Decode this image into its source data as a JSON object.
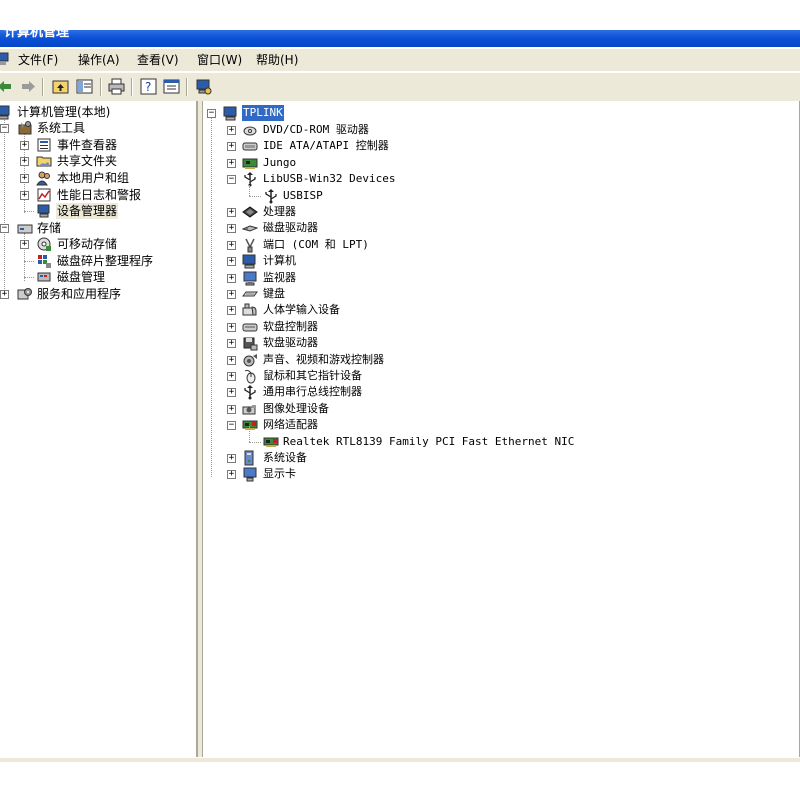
{
  "window": {
    "title": "计算机管理"
  },
  "menu": {
    "file": "文件(F)",
    "action": "操作(A)",
    "view": "查看(V)",
    "window": "窗口(W)",
    "help": "帮助(H)"
  },
  "toolbar": {
    "icons": [
      "back-arrow-icon",
      "forward-arrow-icon",
      "up-folder-icon",
      "show-tree-icon",
      "print-icon",
      "help-icon",
      "properties-icon",
      "scan-hardware-icon"
    ]
  },
  "left_tree": {
    "root": "计算机管理(本地)",
    "system_tools": "系统工具",
    "event_viewer": "事件查看器",
    "shared_folders": "共享文件夹",
    "local_users": "本地用户和组",
    "perf_logs": "性能日志和警报",
    "device_manager": "设备管理器",
    "storage": "存储",
    "removable_storage": "可移动存储",
    "defrag": "磁盘碎片整理程序",
    "disk_management": "磁盘管理",
    "services_apps": "服务和应用程序"
  },
  "device_tree": {
    "root": "TPLINK",
    "items": [
      {
        "label": "DVD/CD-ROM 驱动器",
        "icon": "cdrom-icon",
        "expanded": false
      },
      {
        "label": "IDE ATA/ATAPI 控制器",
        "icon": "ide-controller-icon",
        "expanded": false
      },
      {
        "label": "Jungo",
        "icon": "jungo-card-icon",
        "expanded": false
      },
      {
        "label": "LibUSB-Win32 Devices",
        "icon": "usb-icon",
        "expanded": true
      },
      {
        "label": "USBISP",
        "icon": "usb-icon",
        "child": true
      },
      {
        "label": "处理器",
        "icon": "processor-icon",
        "expanded": false
      },
      {
        "label": "磁盘驱动器",
        "icon": "disk-drive-icon",
        "expanded": false
      },
      {
        "label": "端口 (COM 和 LPT)",
        "icon": "port-icon",
        "expanded": false
      },
      {
        "label": "计算机",
        "icon": "computer-icon",
        "expanded": false
      },
      {
        "label": "监视器",
        "icon": "monitor-icon",
        "expanded": false
      },
      {
        "label": "键盘",
        "icon": "keyboard-icon",
        "expanded": false
      },
      {
        "label": "人体学输入设备",
        "icon": "hid-icon",
        "expanded": false
      },
      {
        "label": "软盘控制器",
        "icon": "floppy-controller-icon",
        "expanded": false
      },
      {
        "label": "软盘驱动器",
        "icon": "floppy-drive-icon",
        "expanded": false
      },
      {
        "label": "声音、视频和游戏控制器",
        "icon": "sound-icon",
        "expanded": false
      },
      {
        "label": "鼠标和其它指针设备",
        "icon": "mouse-icon",
        "expanded": false
      },
      {
        "label": "通用串行总线控制器",
        "icon": "usb-icon",
        "expanded": false
      },
      {
        "label": "图像处理设备",
        "icon": "imaging-icon",
        "expanded": false
      },
      {
        "label": "网络适配器",
        "icon": "network-card-icon",
        "expanded": true
      },
      {
        "label": "Realtek RTL8139 Family PCI Fast Ethernet NIC",
        "icon": "network-card-icon",
        "child": true
      },
      {
        "label": "系统设备",
        "icon": "system-device-icon",
        "expanded": false
      },
      {
        "label": "显示卡",
        "icon": "display-adapter-icon",
        "expanded": false
      }
    ]
  },
  "colors": {
    "titlebar": "#0a4fd6",
    "selection": "#316ac5",
    "chrome": "#ece9d8"
  }
}
